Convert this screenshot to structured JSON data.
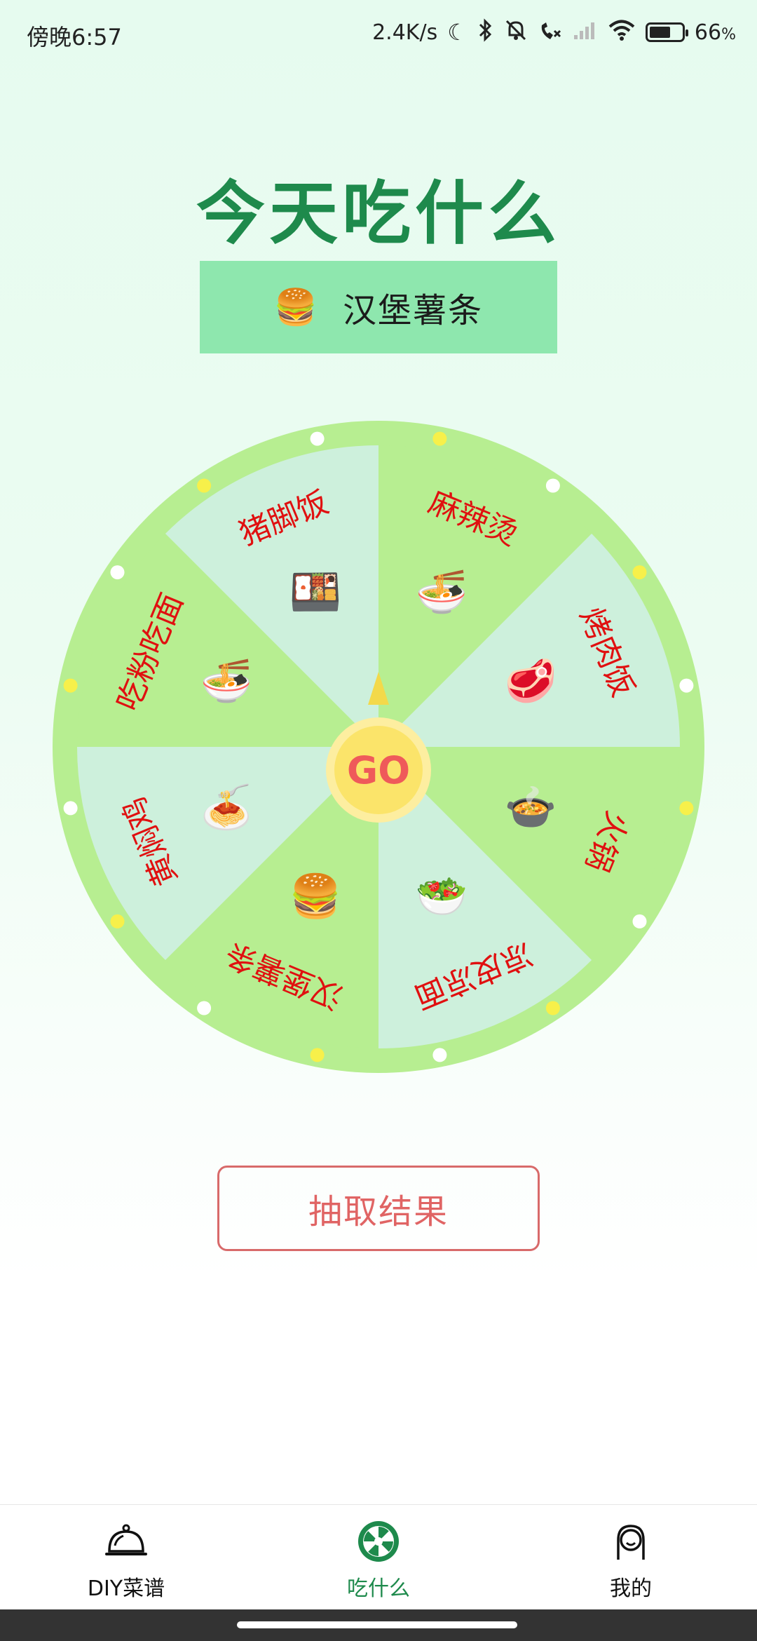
{
  "status_bar": {
    "time": "傍晚6:57",
    "network_speed": "2.4K/s",
    "battery_percent": "66",
    "battery_unit": "%",
    "battery_level": 0.66,
    "icons": [
      "moon-icon",
      "bluetooth-icon",
      "mute-bell-icon",
      "phone-missed-icon",
      "signal-icon",
      "wifi-icon",
      "battery-icon"
    ]
  },
  "page": {
    "title": "今天吃什么",
    "result": {
      "emoji": "🍔",
      "text": "汉堡薯条"
    },
    "go_label": "GO",
    "draw_button": "抽取结果"
  },
  "wheel": {
    "colors": {
      "rim": "#b7ee91",
      "slice_light": "#cdf0dc",
      "slice_green": "#b7ee91",
      "label": "#e01010",
      "go": "#fbe46a"
    },
    "slices": [
      {
        "label": "麻辣烫",
        "food_icon": "🍜"
      },
      {
        "label": "烤肉饭",
        "food_icon": "🥩"
      },
      {
        "label": "火锅",
        "food_icon": "🍲"
      },
      {
        "label": "凉皮凉面",
        "food_icon": "🥗"
      },
      {
        "label": "汉堡薯条",
        "food_icon": "🍔"
      },
      {
        "label": "黄焖鸡",
        "food_icon": "🍝"
      },
      {
        "label": "吃粉吃面",
        "food_icon": "🍜"
      },
      {
        "label": "猪脚饭",
        "food_icon": "🍱"
      }
    ]
  },
  "nav": {
    "items": [
      {
        "label": "DIY菜谱",
        "icon": "cloche-icon",
        "active": false
      },
      {
        "label": "吃什么",
        "icon": "wheel-icon",
        "active": true
      },
      {
        "label": "我的",
        "icon": "profile-icon",
        "active": false
      }
    ]
  }
}
